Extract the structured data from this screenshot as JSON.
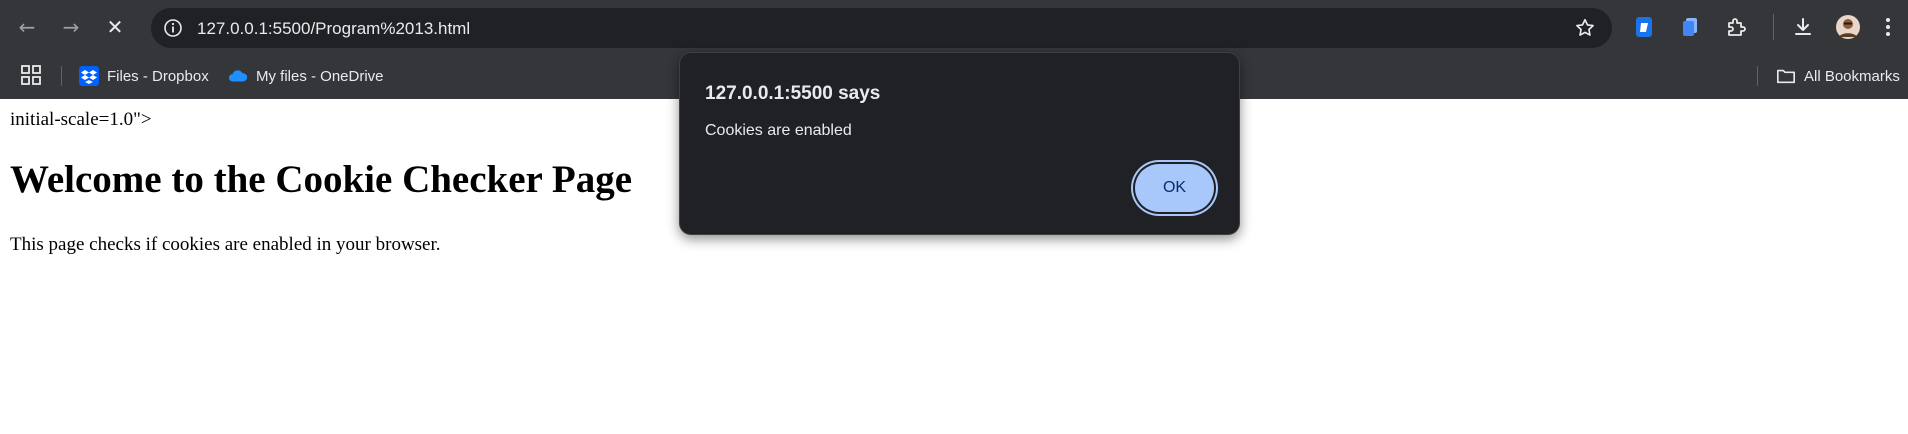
{
  "browser": {
    "url": "127.0.0.1:5500/Program%2013.html",
    "colors": {
      "chrome_bg": "#35363a",
      "omnibox_bg": "#202124",
      "text": "#e8eaed"
    }
  },
  "bookmarks": {
    "items": [
      {
        "label": "Files - Dropbox",
        "icon": "dropbox-icon"
      },
      {
        "label": "My files - OneDrive",
        "icon": "onedrive-icon"
      }
    ],
    "all_bookmarks": "All Bookmarks"
  },
  "page": {
    "meta_text": "initial-scale=1.0\">",
    "title": "Welcome to the Cookie Checker Page",
    "description": "This page checks if cookies are enabled in your browser."
  },
  "dialog": {
    "title": "127.0.0.1:5500 says",
    "message": "Cookies are enabled",
    "ok_label": "OK",
    "colors": {
      "bg": "#202124",
      "button": "#a8c7fa",
      "button_text": "#062e6f"
    }
  }
}
